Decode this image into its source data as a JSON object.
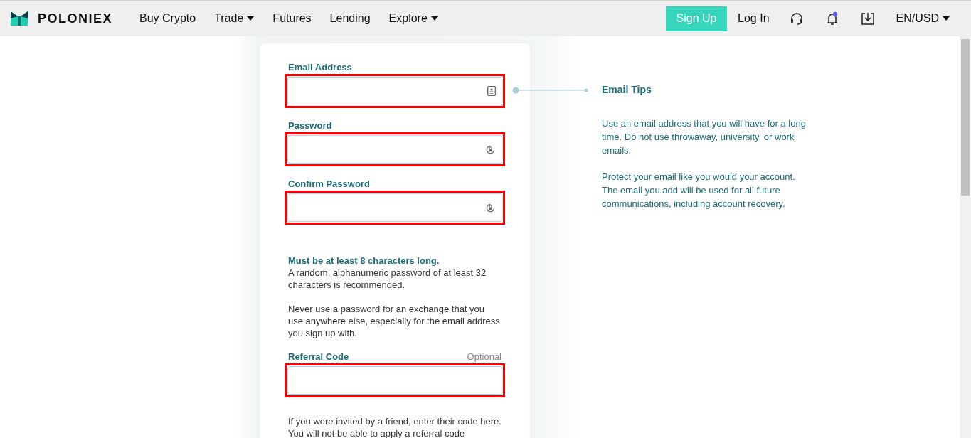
{
  "header": {
    "brand": "POLONIEX",
    "nav": [
      {
        "label": "Buy Crypto",
        "dropdown": false
      },
      {
        "label": "Trade",
        "dropdown": true
      },
      {
        "label": "Futures",
        "dropdown": false
      },
      {
        "label": "Lending",
        "dropdown": false
      },
      {
        "label": "Explore",
        "dropdown": true
      }
    ],
    "sign_up": "Sign Up",
    "log_in": "Log In",
    "notification_dot": true,
    "locale": "EN/USD"
  },
  "form": {
    "fields": [
      {
        "label": "Email Address",
        "kind": "email",
        "highlighted": true
      },
      {
        "label": "Password",
        "kind": "password",
        "highlighted": true
      },
      {
        "label": "Confirm Password",
        "kind": "password",
        "highlighted": true
      }
    ],
    "rule": "Must be at least 8 characters long.",
    "hints": [
      "A random, alphanumeric password of at least 32 characters is recommended.",
      "Never use a password for an exchange that you use anywhere else, especially for the email address you sign up with."
    ],
    "referral": {
      "label": "Referral Code",
      "optional": "Optional",
      "highlighted": true
    },
    "referral_note": "If you were invited by a friend, enter their code here. You will not be able to apply a referral code"
  },
  "tips": {
    "title": "Email Tips",
    "paragraphs": [
      "Use an email address that you will have for a long time. Do not use throwaway, university, or work emails.",
      "Protect your email like you would your account. The email you add will be used for all future communications, including account recovery."
    ]
  }
}
